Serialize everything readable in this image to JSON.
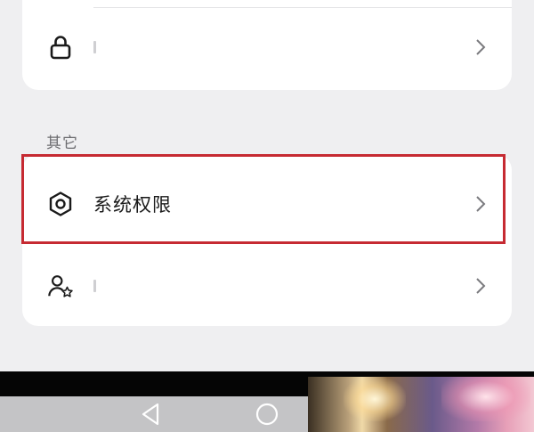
{
  "top_card": {
    "lock_item": {
      "icon": "lock-icon",
      "chevron": "chevron-right-icon"
    }
  },
  "section": {
    "title": "其它"
  },
  "other_card": {
    "permission_item": {
      "label": "系统权限",
      "icon": "hexagon-settings-icon",
      "chevron": "chevron-right-icon"
    },
    "user_item": {
      "icon": "user-star-icon",
      "chevron": "chevron-right-icon"
    }
  },
  "highlight_color": "#c62a32",
  "nav": {
    "back_icon": "triangle-back-icon",
    "home_icon": "circle-home-icon"
  }
}
